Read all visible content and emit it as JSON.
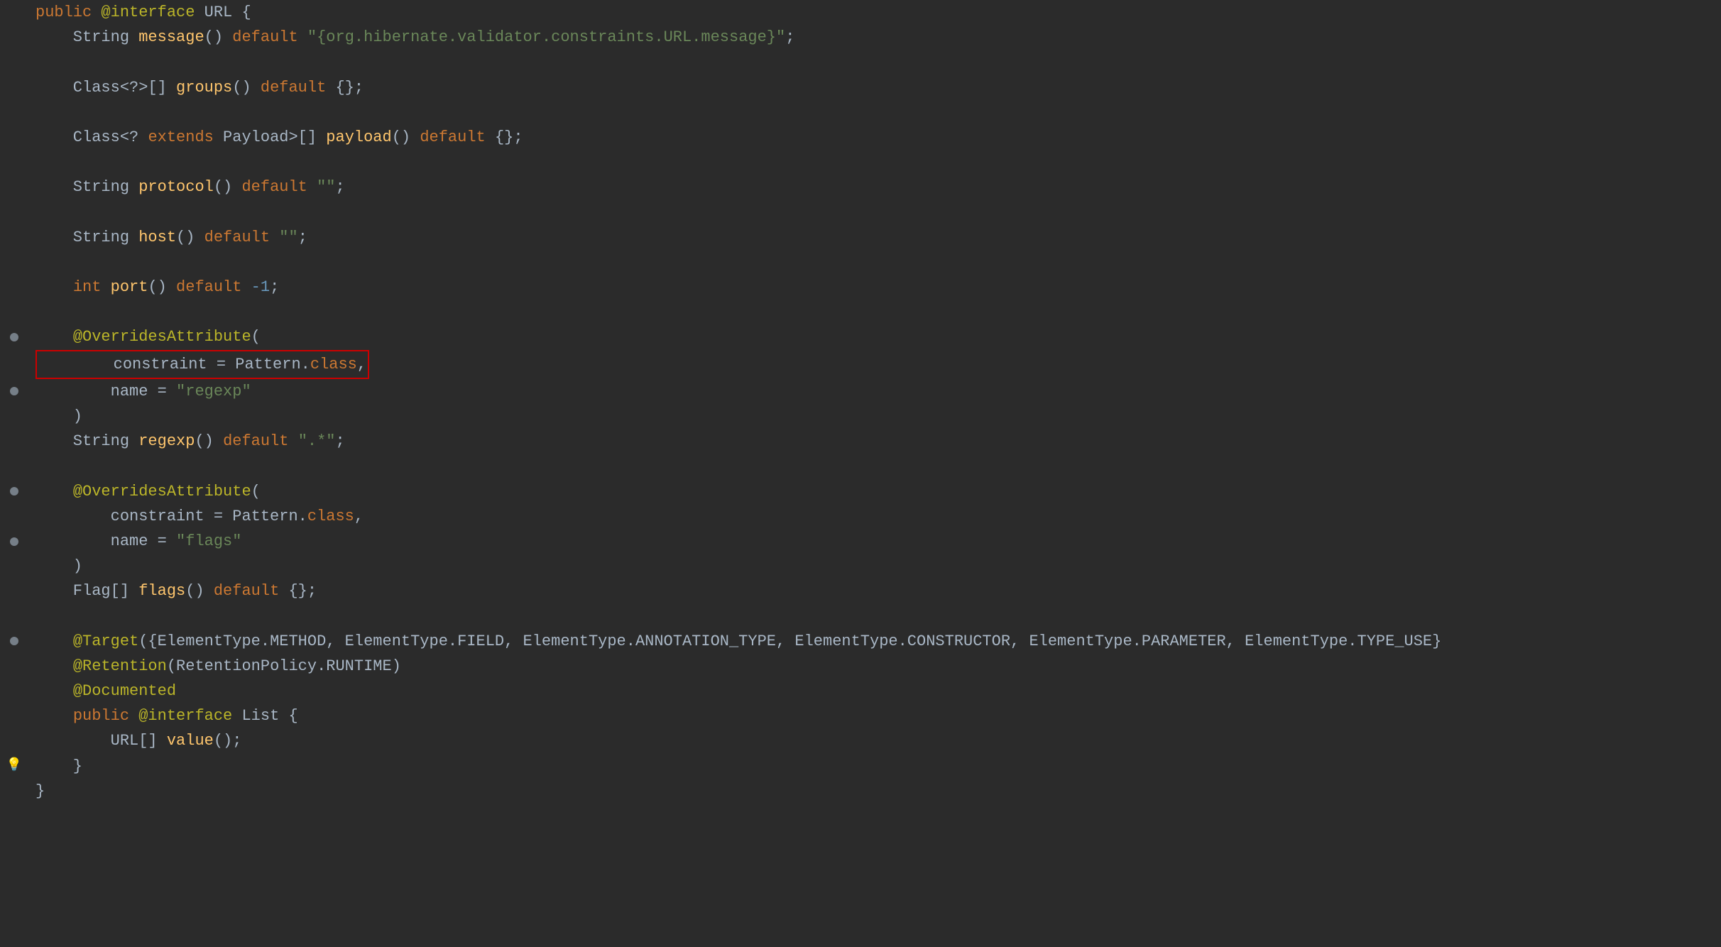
{
  "editor": {
    "background": "#2b2b2b",
    "lines": [
      {
        "id": 1,
        "gutter": null,
        "tokens": [
          {
            "text": "public ",
            "cls": "kw-public"
          },
          {
            "text": "@interface",
            "cls": "annotation"
          },
          {
            "text": " URL {",
            "cls": "plain"
          }
        ]
      },
      {
        "id": 2,
        "gutter": null,
        "tokens": [
          {
            "text": "    String ",
            "cls": "plain"
          },
          {
            "text": "message",
            "cls": "method-name"
          },
          {
            "text": "() ",
            "cls": "plain"
          },
          {
            "text": "default",
            "cls": "kw-default"
          },
          {
            "text": " ",
            "cls": "plain"
          },
          {
            "text": "\"{org.hibernate.validator.constraints.URL.message}\"",
            "cls": "string-val"
          },
          {
            "text": ";",
            "cls": "plain"
          }
        ]
      },
      {
        "id": 3,
        "blank": true
      },
      {
        "id": 4,
        "gutter": null,
        "tokens": [
          {
            "text": "    Class<?>[] ",
            "cls": "plain"
          },
          {
            "text": "groups",
            "cls": "method-name"
          },
          {
            "text": "() ",
            "cls": "plain"
          },
          {
            "text": "default",
            "cls": "kw-default"
          },
          {
            "text": " {};",
            "cls": "plain"
          }
        ]
      },
      {
        "id": 5,
        "blank": true
      },
      {
        "id": 6,
        "gutter": null,
        "tokens": [
          {
            "text": "    Class<? ",
            "cls": "plain"
          },
          {
            "text": "extends",
            "cls": "kw-extends"
          },
          {
            "text": " Payload>[] ",
            "cls": "plain"
          },
          {
            "text": "payload",
            "cls": "method-name"
          },
          {
            "text": "() ",
            "cls": "plain"
          },
          {
            "text": "default",
            "cls": "kw-default"
          },
          {
            "text": " {};",
            "cls": "plain"
          }
        ]
      },
      {
        "id": 7,
        "blank": true
      },
      {
        "id": 8,
        "gutter": null,
        "tokens": [
          {
            "text": "    String ",
            "cls": "plain"
          },
          {
            "text": "protocol",
            "cls": "method-name"
          },
          {
            "text": "() ",
            "cls": "plain"
          },
          {
            "text": "default",
            "cls": "kw-default"
          },
          {
            "text": " ",
            "cls": "plain"
          },
          {
            "text": "\"\"",
            "cls": "string-val"
          },
          {
            "text": ";",
            "cls": "plain"
          }
        ]
      },
      {
        "id": 9,
        "blank": true
      },
      {
        "id": 10,
        "gutter": null,
        "tokens": [
          {
            "text": "    String ",
            "cls": "plain"
          },
          {
            "text": "host",
            "cls": "method-name"
          },
          {
            "text": "() ",
            "cls": "plain"
          },
          {
            "text": "default",
            "cls": "kw-default"
          },
          {
            "text": " ",
            "cls": "plain"
          },
          {
            "text": "\"\"",
            "cls": "string-val"
          },
          {
            "text": ";",
            "cls": "plain"
          }
        ]
      },
      {
        "id": 11,
        "blank": true
      },
      {
        "id": 12,
        "gutter": null,
        "tokens": [
          {
            "text": "    ",
            "cls": "plain"
          },
          {
            "text": "int",
            "cls": "kw-int"
          },
          {
            "text": " ",
            "cls": "plain"
          },
          {
            "text": "port",
            "cls": "method-name"
          },
          {
            "text": "() ",
            "cls": "plain"
          },
          {
            "text": "default",
            "cls": "kw-default"
          },
          {
            "text": " ",
            "cls": "plain"
          },
          {
            "text": "-1",
            "cls": "number-val"
          },
          {
            "text": ";",
            "cls": "plain"
          }
        ]
      },
      {
        "id": 13,
        "blank": true
      },
      {
        "id": 14,
        "gutter": "dot",
        "tokens": [
          {
            "text": "    ",
            "cls": "plain"
          },
          {
            "text": "@OverridesAttribute",
            "cls": "annotation"
          },
          {
            "text": "(",
            "cls": "plain"
          }
        ]
      },
      {
        "id": 15,
        "gutter": null,
        "selected": true,
        "tokens": [
          {
            "text": "        constraint = Pattern.",
            "cls": "plain"
          },
          {
            "text": "class",
            "cls": "kw-class"
          },
          {
            "text": ",",
            "cls": "plain"
          }
        ]
      },
      {
        "id": 16,
        "gutter": "dot",
        "tokens": [
          {
            "text": "        name = ",
            "cls": "plain"
          },
          {
            "text": "\"regexp\"",
            "cls": "string-val"
          }
        ]
      },
      {
        "id": 17,
        "gutter": null,
        "tokens": [
          {
            "text": "    )",
            "cls": "plain"
          }
        ]
      },
      {
        "id": 18,
        "gutter": null,
        "tokens": [
          {
            "text": "    String ",
            "cls": "plain"
          },
          {
            "text": "regexp",
            "cls": "method-name"
          },
          {
            "text": "() ",
            "cls": "plain"
          },
          {
            "text": "default",
            "cls": "kw-default"
          },
          {
            "text": " ",
            "cls": "plain"
          },
          {
            "text": "\".*\"",
            "cls": "string-val"
          },
          {
            "text": ";",
            "cls": "plain"
          }
        ]
      },
      {
        "id": 19,
        "blank": true
      },
      {
        "id": 20,
        "gutter": "dot",
        "tokens": [
          {
            "text": "    ",
            "cls": "plain"
          },
          {
            "text": "@OverridesAttribute",
            "cls": "annotation"
          },
          {
            "text": "(",
            "cls": "plain"
          }
        ]
      },
      {
        "id": 21,
        "gutter": null,
        "tokens": [
          {
            "text": "        constraint = Pattern.",
            "cls": "plain"
          },
          {
            "text": "class",
            "cls": "kw-class"
          },
          {
            "text": ",",
            "cls": "plain"
          }
        ]
      },
      {
        "id": 22,
        "gutter": "dot",
        "tokens": [
          {
            "text": "        name = ",
            "cls": "plain"
          },
          {
            "text": "\"flags\"",
            "cls": "string-val"
          }
        ]
      },
      {
        "id": 23,
        "gutter": null,
        "tokens": [
          {
            "text": "    )",
            "cls": "plain"
          }
        ]
      },
      {
        "id": 24,
        "gutter": null,
        "tokens": [
          {
            "text": "    Flag[] ",
            "cls": "plain"
          },
          {
            "text": "flags",
            "cls": "method-name"
          },
          {
            "text": "() ",
            "cls": "plain"
          },
          {
            "text": "default",
            "cls": "kw-default"
          },
          {
            "text": " {};",
            "cls": "plain"
          }
        ]
      },
      {
        "id": 25,
        "blank": true
      },
      {
        "id": 26,
        "gutter": "dot",
        "tokens": [
          {
            "text": "    ",
            "cls": "plain"
          },
          {
            "text": "@Target",
            "cls": "annotation"
          },
          {
            "text": "({ElementType.METHOD, ElementType.FIELD, ElementType.ANNOTATION_TYPE, ElementType.CONSTRUCTOR, ElementType.PARAMETER, ElementType.TYPE_USE}",
            "cls": "plain"
          }
        ]
      },
      {
        "id": 27,
        "gutter": null,
        "tokens": [
          {
            "text": "    ",
            "cls": "plain"
          },
          {
            "text": "@Retention",
            "cls": "annotation"
          },
          {
            "text": "(RetentionPolicy.RUNTIME)",
            "cls": "plain"
          }
        ]
      },
      {
        "id": 28,
        "gutter": null,
        "tokens": [
          {
            "text": "    ",
            "cls": "plain"
          },
          {
            "text": "@Documented",
            "cls": "annotation"
          }
        ]
      },
      {
        "id": 29,
        "gutter": null,
        "tokens": [
          {
            "text": "    ",
            "cls": "plain"
          },
          {
            "text": "public",
            "cls": "kw-public"
          },
          {
            "text": " ",
            "cls": "plain"
          },
          {
            "text": "@interface",
            "cls": "annotation"
          },
          {
            "text": " List {",
            "cls": "plain"
          }
        ]
      },
      {
        "id": 30,
        "gutter": null,
        "tokens": [
          {
            "text": "        URL[] ",
            "cls": "plain"
          },
          {
            "text": "value",
            "cls": "method-name"
          },
          {
            "text": "();",
            "cls": "plain"
          }
        ]
      },
      {
        "id": 31,
        "gutter": "bulb",
        "tokens": [
          {
            "text": "    }",
            "cls": "plain"
          }
        ]
      },
      {
        "id": 32,
        "gutter": null,
        "tokens": [
          {
            "text": "}",
            "cls": "plain"
          }
        ]
      }
    ]
  }
}
